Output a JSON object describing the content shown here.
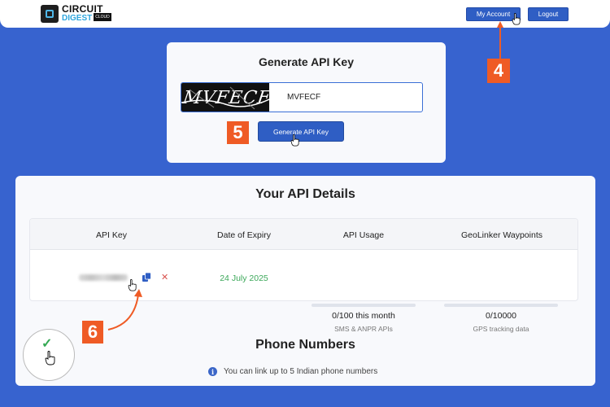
{
  "header": {
    "logo_line1": "CIRCUIT",
    "logo_line2": "DIGEST",
    "logo_tag": "CLOUD",
    "my_account_label": "My Account",
    "logout_label": "Logout"
  },
  "generate": {
    "title": "Generate API Key",
    "captcha_image_text": "MVFECF",
    "captcha_input_value": "MVFECF",
    "button_label": "Generate API Key"
  },
  "details": {
    "title": "Your API Details",
    "columns": [
      "API Key",
      "Date of Expiry",
      "API Usage",
      "GeoLinker Waypoints"
    ],
    "row": {
      "expiry": "24 July 2025",
      "usage_main": "0/100 this month",
      "usage_sub": "SMS & ANPR APIs",
      "usage_fraction": 0,
      "geo_main": "0/10000",
      "geo_sub": "GPS tracking data",
      "geo_fraction": 0
    }
  },
  "phone": {
    "title": "Phone Numbers",
    "info": "You can link up to 5 Indian phone numbers"
  },
  "annotations": {
    "step4": "4",
    "step5": "5",
    "step6": "6"
  },
  "colors": {
    "background": "#3763cf",
    "primary_button": "#2f5ec4",
    "callout": "#ef5b25",
    "expiry_green": "#3ca85a",
    "remove_red": "#d9534f"
  },
  "icons": [
    "logo-chip-icon",
    "cursor-hand-icon",
    "copy-icon",
    "close-icon",
    "info-icon",
    "checkmark-icon"
  ]
}
